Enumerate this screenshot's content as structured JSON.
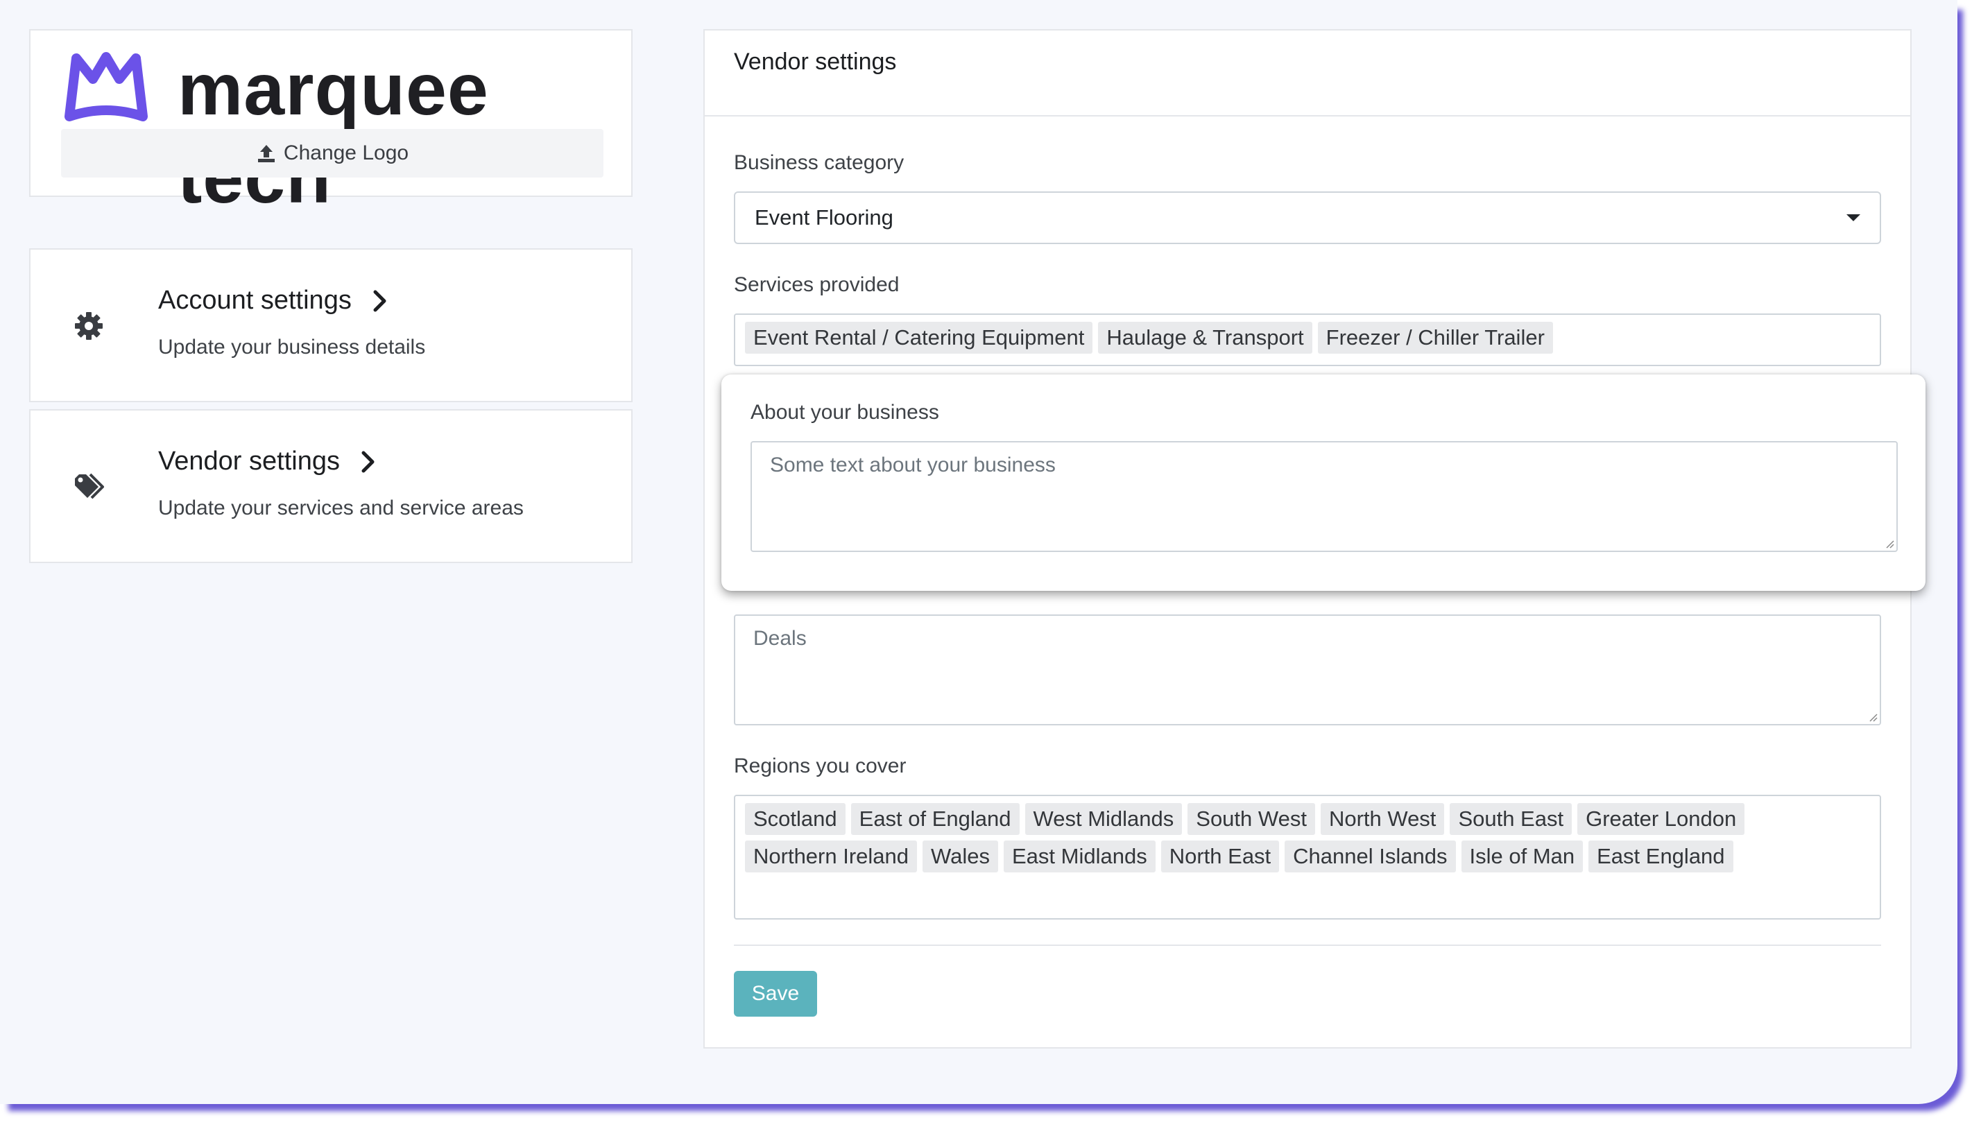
{
  "logo": {
    "brand_text": "marquee tech",
    "change_logo_label": "Change Logo",
    "brand_color": "#6b52e8"
  },
  "nav": {
    "account": {
      "title": "Account settings",
      "subtitle": "Update your business details",
      "icon": "gear-icon"
    },
    "vendor": {
      "title": "Vendor settings",
      "subtitle": "Update your services and service areas",
      "icon": "tags-icon"
    }
  },
  "main": {
    "title": "Vendor settings",
    "business_category": {
      "label": "Business category",
      "value": "Event Flooring"
    },
    "services": {
      "label": "Services provided",
      "tags": [
        "Event Rental / Catering Equipment",
        "Haulage & Transport",
        "Freezer / Chiller Trailer"
      ]
    },
    "about": {
      "label": "About your business",
      "placeholder": "Some text about your business"
    },
    "deals": {
      "placeholder": "Deals"
    },
    "regions": {
      "label": "Regions you cover",
      "tags": [
        "Scotland",
        "East of England",
        "West Midlands",
        "South West",
        "North West",
        "South East",
        "Greater London",
        "Northern Ireland",
        "Wales",
        "East Midlands",
        "North East",
        "Channel Islands",
        "Isle of Man",
        "East England"
      ]
    },
    "save_label": "Save",
    "save_color": "#5bb3bd"
  }
}
